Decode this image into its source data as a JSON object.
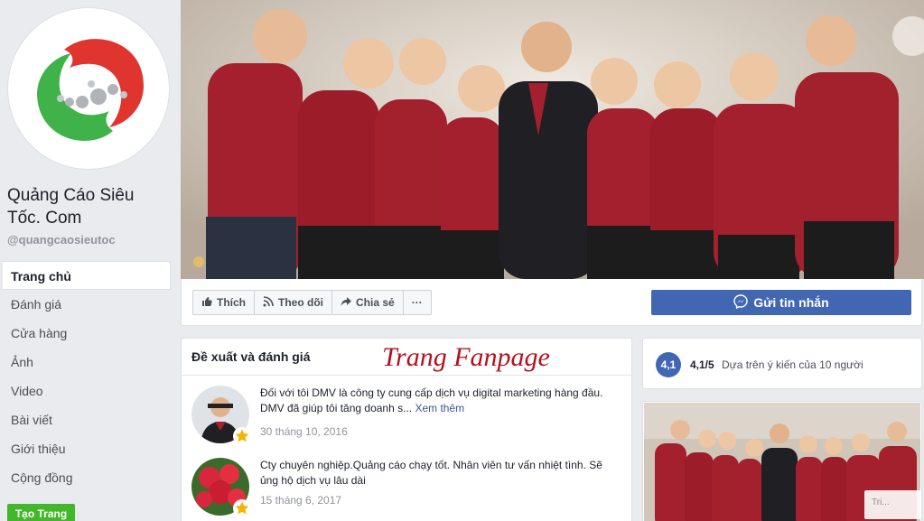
{
  "page": {
    "name": "Quảng Cáo Siêu Tốc. Com",
    "handle": "@quangcaosieutoc"
  },
  "nav": {
    "items": [
      {
        "label": "Trang chủ"
      },
      {
        "label": "Đánh giá"
      },
      {
        "label": "Cửa hàng"
      },
      {
        "label": "Ảnh"
      },
      {
        "label": "Video"
      },
      {
        "label": "Bài viết"
      },
      {
        "label": "Giới thiệu"
      },
      {
        "label": "Cộng đồng"
      }
    ],
    "create_label": "Tạo Trang"
  },
  "actions": {
    "like": "Thích",
    "follow": "Theo dõi",
    "share": "Chia sẻ",
    "more": "···",
    "message": "Gửi tin nhắn"
  },
  "reviews": {
    "title": "Đề xuất và đánh giá",
    "watermark": "Trang Fanpage",
    "items": [
      {
        "text": "Đối với tôi DMV là công ty cung cấp dịch vụ digital marketing hàng đầu. DMV đã giúp tôi tăng doanh s...",
        "more": "Xem thêm",
        "date": "30 tháng 10, 2016"
      },
      {
        "text": "Cty chuyên nghiệp.Quảng cáo chạy tốt. Nhân viên tư vấn nhiệt tình. Sẽ ủng hộ dịch vụ lâu dài",
        "more": "",
        "date": "15 tháng 6, 2017"
      }
    ]
  },
  "rating": {
    "badge": "4,1",
    "score": "4,1/5",
    "description": "Dựa trên ý kiến của 10 người"
  },
  "photo": {
    "tag": "Tri..."
  },
  "colors": {
    "brand_blue": "#4267b2",
    "link_blue": "#365899",
    "create_green": "#42b72a",
    "logo_red": "#e0342f",
    "logo_green": "#3fb34a",
    "watermark_red": "#b4111d",
    "shirt": "#a5202e"
  }
}
